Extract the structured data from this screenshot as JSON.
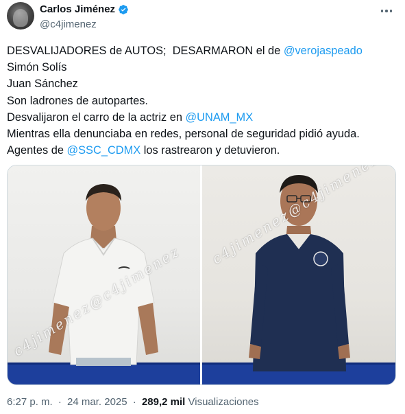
{
  "author": {
    "display_name": "Carlos Jiménez",
    "handle": "@c4jimenez"
  },
  "tweet": {
    "lines": [
      {
        "text": "DESVALIJADORES de AUTOS;  DESARMARON el de ",
        "mention": "@verojaspeado"
      },
      {
        "text": "Simón Solís"
      },
      {
        "text": "Juan Sánchez"
      },
      {
        "text": "Son ladrones de autopartes."
      },
      {
        "text": "Desvalijaron el carro de la actriz en ",
        "mention": "@UNAM_MX"
      },
      {
        "text": "Mientras ella denunciaba en redes, personal de seguridad pidió ayuda."
      },
      {
        "text": "Agentes de ",
        "mention": "@SSC_CDMX",
        "text_after": " los rastrearon y detuvieron."
      }
    ]
  },
  "media": {
    "watermark": "c4jimenez@c4jimenez",
    "photos": [
      {
        "alt": "man in white polo shirt"
      },
      {
        "alt": "man in navy polo shirt with glasses"
      }
    ]
  },
  "meta": {
    "time": "6:27 p. m.",
    "separator": "·",
    "date": "24 mar. 2025",
    "views_count": "289,2 mil",
    "views_label": "Visualizaciones"
  },
  "colors": {
    "text": "#0f1419",
    "secondary": "#536471",
    "link": "#1d9bf0",
    "verified": "#1d9bf0",
    "floor": "#1d3f9c"
  },
  "icons": [
    "verified-badge-icon",
    "more-options-icon"
  ]
}
